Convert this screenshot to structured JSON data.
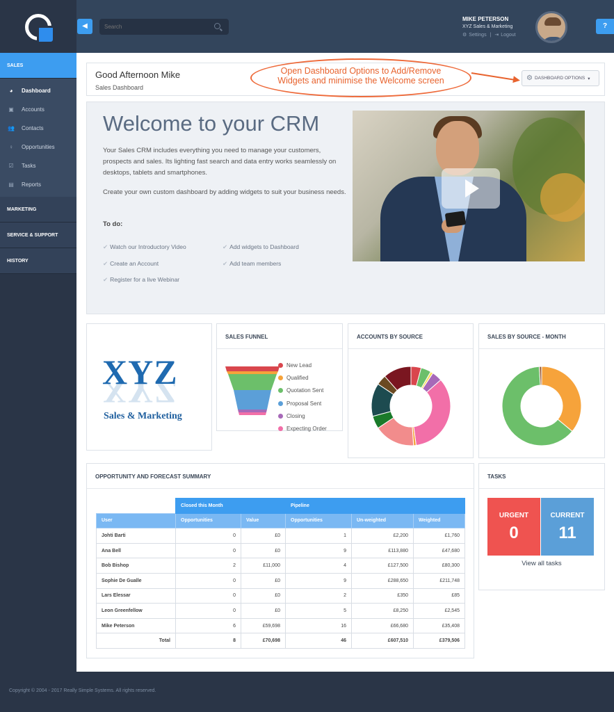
{
  "header": {
    "search_placeholder": "Search",
    "user_name": "MIKE PETERSON",
    "user_company": "XYZ Sales & Marketing",
    "settings_label": "Settings",
    "logout_label": "Logout",
    "help_label": "?"
  },
  "sidebar": {
    "sections": [
      {
        "label": "SALES"
      },
      {
        "label": "MARKETING"
      },
      {
        "label": "SERVICE & SUPPORT"
      },
      {
        "label": "HISTORY"
      }
    ],
    "items": [
      {
        "label": "Dashboard",
        "icon": "dashboard-icon"
      },
      {
        "label": "Accounts",
        "icon": "building-icon"
      },
      {
        "label": "Contacts",
        "icon": "users-icon"
      },
      {
        "label": "Opportunities",
        "icon": "lightbulb-icon"
      },
      {
        "label": "Tasks",
        "icon": "checkbox-icon"
      },
      {
        "label": "Reports",
        "icon": "reports-icon"
      }
    ]
  },
  "greeting": {
    "title": "Good Afternoon Mike",
    "subtitle": "Sales Dashboard",
    "options_label": "DASHBOARD OPTIONS"
  },
  "annotation": {
    "line1": "Open Dashboard Options to Add/Remove",
    "line2": "Widgets and minimise the Welcome screen",
    "color": "#e8632e"
  },
  "welcome": {
    "title": "Welcome to your CRM",
    "para1": "Your Sales CRM includes everything you need to manage your customers, prospects and sales. Its lighting fast search and data entry works seamlessly on desktops, tablets and smartphones.",
    "para2": "Create your own custom dashboard by adding widgets to suit your business needs.",
    "todo_heading": "To do:",
    "todos": [
      "Watch our Introductory Video",
      "Add widgets to Dashboard",
      "Create an Account",
      "Add team members",
      "Register for a live Webinar"
    ]
  },
  "logo_widget": {
    "brand": "XYZ",
    "tagline": "Sales & Marketing"
  },
  "funnel": {
    "title": "SALES FUNNEL",
    "legend": [
      {
        "label": "New Lead",
        "color": "#d9464d"
      },
      {
        "label": "Qualified",
        "color": "#f6a33b"
      },
      {
        "label": "Quotation Sent",
        "color": "#6cbf6a"
      },
      {
        "label": "Proposal Sent",
        "color": "#5b9fd8"
      },
      {
        "label": "Closing",
        "color": "#a769b8"
      },
      {
        "label": "Expecting Order",
        "color": "#f26fa8"
      }
    ]
  },
  "accounts_by_source": {
    "title": "ACCOUNTS BY SOURCE",
    "slices": [
      {
        "value": 4,
        "color": "#d9464d"
      },
      {
        "value": 4,
        "color": "#6cbf6a"
      },
      {
        "value": 1,
        "color": "#f6e05a"
      },
      {
        "value": 4,
        "color": "#a769b8"
      },
      {
        "value": 33,
        "color": "#f26fa8"
      },
      {
        "value": 1,
        "color": "#f6a33b"
      },
      {
        "value": 16,
        "color": "#f28c8c"
      },
      {
        "value": 5,
        "color": "#1a7a2a"
      },
      {
        "value": 13,
        "color": "#1d4b50"
      },
      {
        "value": 4,
        "color": "#6b4a22"
      },
      {
        "value": 11,
        "color": "#7a1620"
      }
    ]
  },
  "sales_by_source": {
    "title": "SALES BY SOURCE - MONTH",
    "slices": [
      {
        "value": 36,
        "color": "#f6a33b"
      },
      {
        "value": 63,
        "color": "#6cbf6a"
      },
      {
        "value": 1,
        "color": "#a0694a"
      }
    ]
  },
  "opportunity": {
    "title": "OPPORTUNITY AND FORECAST SUMMARY",
    "group_closed": "Closed this Month",
    "group_pipeline": "Pipeline",
    "columns": [
      "User",
      "Opportunities",
      "Value",
      "Opportunities",
      "Un-weighted",
      "Weighted"
    ],
    "rows": [
      [
        "Johti Barti",
        "0",
        "£0",
        "1",
        "£2,200",
        "£1,760"
      ],
      [
        "Ana Bell",
        "0",
        "£0",
        "9",
        "£113,880",
        "£47,680"
      ],
      [
        "Bob Bishop",
        "2",
        "£11,000",
        "4",
        "£127,500",
        "£80,300"
      ],
      [
        "Sophie De Gualle",
        "0",
        "£0",
        "9",
        "£288,650",
        "£211,748"
      ],
      [
        "Lars Elessar",
        "0",
        "£0",
        "2",
        "£350",
        "£85"
      ],
      [
        "Leon Greenfellow",
        "0",
        "£0",
        "5",
        "£8,250",
        "£2,545"
      ],
      [
        "Mike Peterson",
        "6",
        "£59,698",
        "16",
        "£66,680",
        "£35,408"
      ]
    ],
    "total": [
      "Total",
      "8",
      "£70,698",
      "46",
      "£607,510",
      "£379,506"
    ]
  },
  "tasks": {
    "title": "TASKS",
    "urgent_label": "URGENT",
    "urgent_count": "0",
    "current_label": "CURRENT",
    "current_count": "11",
    "view_all": "View all tasks",
    "urgent_color": "#ef5350",
    "current_color": "#5b9fd8"
  },
  "footer": {
    "copyright": "Copyright © 2004 - 2017 Really Simple Systems. All rights reserved."
  }
}
